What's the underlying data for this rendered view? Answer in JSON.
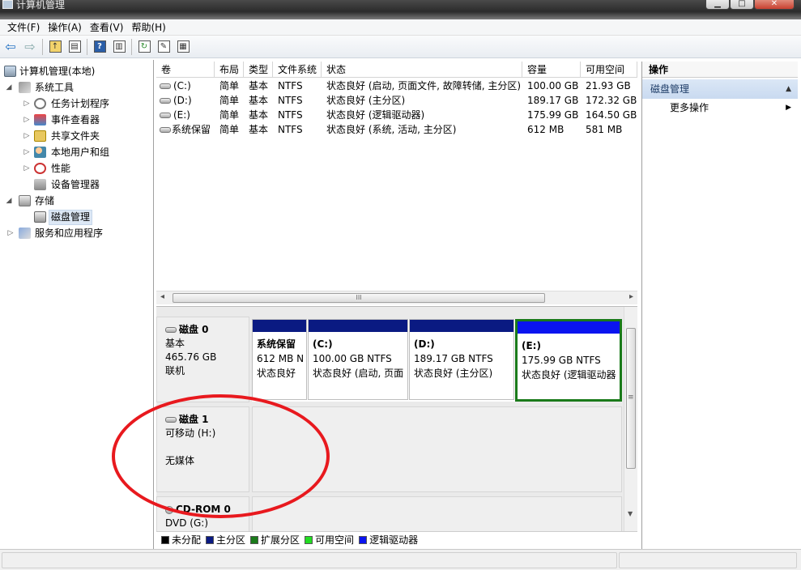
{
  "window": {
    "title": "计算机管理"
  },
  "menu": [
    "文件(F)",
    "操作(A)",
    "查看(V)",
    "帮助(H)"
  ],
  "tree": {
    "root": "计算机管理(本地)",
    "system_tools": "系统工具",
    "task_scheduler": "任务计划程序",
    "event_viewer": "事件查看器",
    "shared_folders": "共享文件夹",
    "local_users": "本地用户和组",
    "performance": "性能",
    "device_manager": "设备管理器",
    "storage": "存储",
    "disk_management": "磁盘管理",
    "services_apps": "服务和应用程序"
  },
  "volumes": {
    "headers": [
      "卷",
      "布局",
      "类型",
      "文件系统",
      "状态",
      "容量",
      "可用空间"
    ],
    "rows": [
      [
        "(C:)",
        "简单",
        "基本",
        "NTFS",
        "状态良好 (启动, 页面文件, 故障转储, 主分区)",
        "100.00 GB",
        "21.93 GB"
      ],
      [
        "(D:)",
        "简单",
        "基本",
        "NTFS",
        "状态良好 (主分区)",
        "189.17 GB",
        "172.32 GB"
      ],
      [
        "(E:)",
        "简单",
        "基本",
        "NTFS",
        "状态良好 (逻辑驱动器)",
        "175.99 GB",
        "164.50 GB"
      ],
      [
        "系统保留",
        "简单",
        "基本",
        "NTFS",
        "状态良好 (系统, 活动, 主分区)",
        "612 MB",
        "581 MB"
      ]
    ]
  },
  "hscroll_grip": "III",
  "disks": {
    "disk0": {
      "name": "磁盘 0",
      "type": "基本",
      "size": "465.76 GB",
      "status": "联机"
    },
    "disk1": {
      "name": "磁盘 1",
      "type": "可移动 (H:)",
      "media": "无媒体"
    },
    "cdrom": {
      "name": "CD-ROM 0",
      "type": "DVD (G:)"
    }
  },
  "partitions": [
    {
      "name": "系统保留",
      "size": "612 MB N",
      "status": "状态良好"
    },
    {
      "name": "(C:)",
      "size": "100.00 GB NTFS",
      "status": "状态良好 (启动, 页面"
    },
    {
      "name": "(D:)",
      "size": "189.17 GB NTFS",
      "status": "状态良好 (主分区)"
    },
    {
      "name": "(E:)",
      "size": "175.99 GB NTFS",
      "status": "状态良好 (逻辑驱动器"
    }
  ],
  "vscroll_grip": "≡",
  "legend": [
    {
      "label": "未分配",
      "color": "#000000"
    },
    {
      "label": "主分区",
      "color": "#0a1a82"
    },
    {
      "label": "扩展分区",
      "color": "#1a7a1a"
    },
    {
      "label": "可用空间",
      "color": "#22dd22"
    },
    {
      "label": "逻辑驱动器",
      "color": "#0a14f0"
    }
  ],
  "actions": {
    "header": "操作",
    "section": "磁盘管理",
    "more": "更多操作"
  },
  "annotation_color": "#e8191e"
}
